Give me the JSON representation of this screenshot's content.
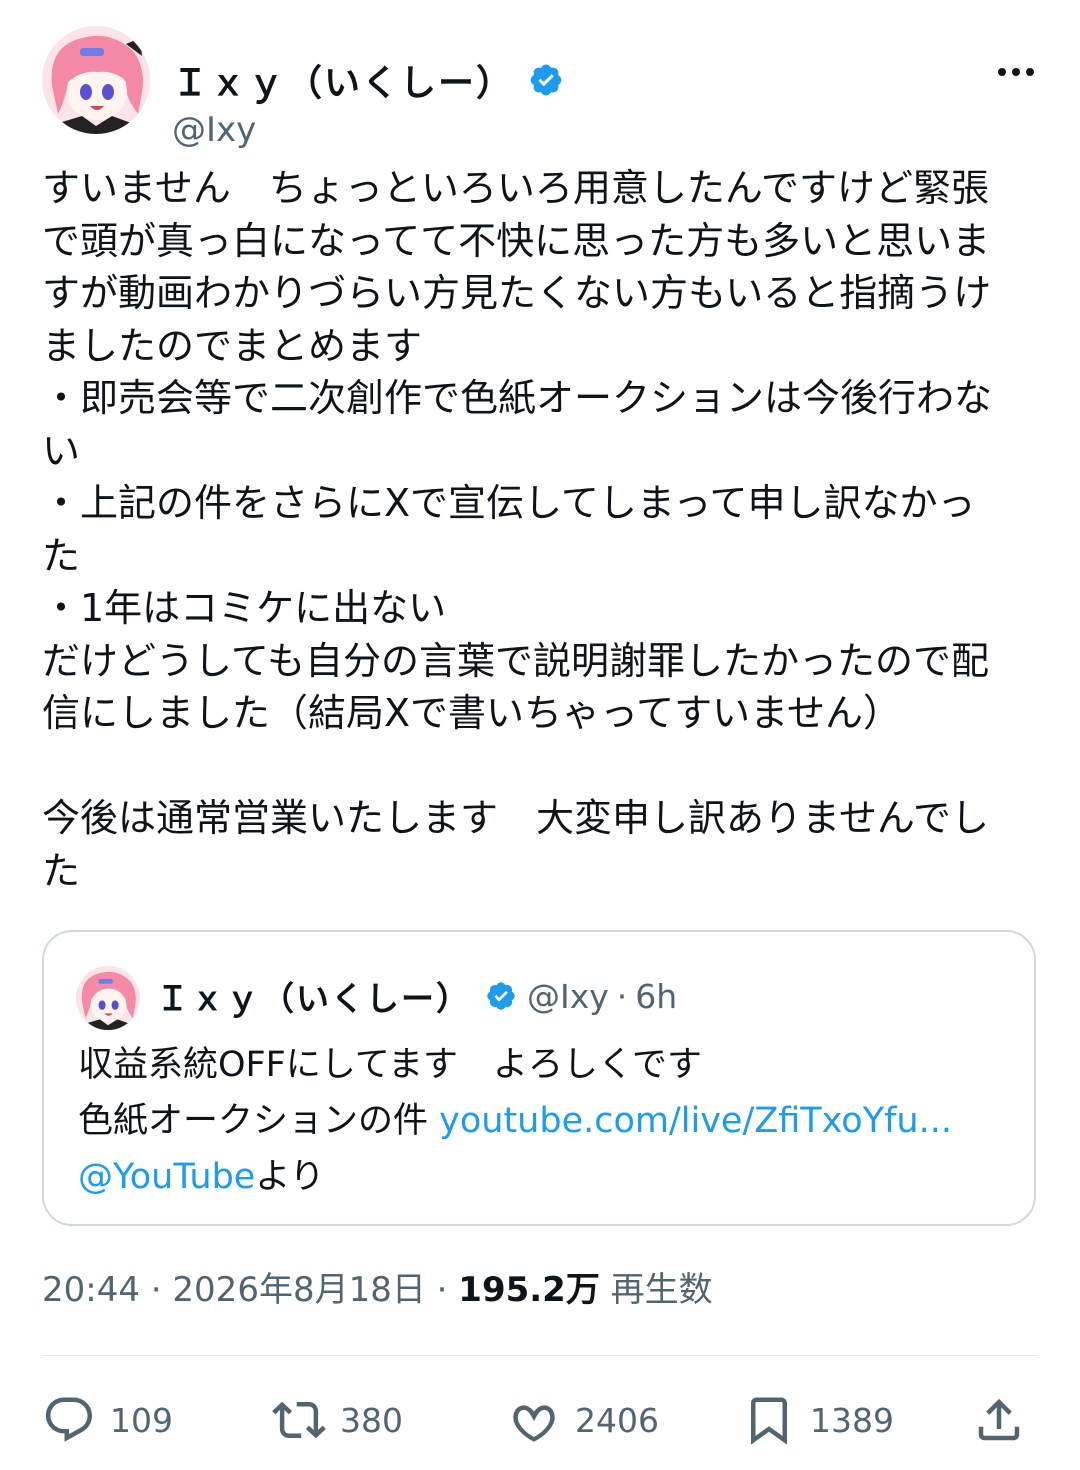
{
  "author": {
    "display_name": "Ｉｘｙ（いくしー）",
    "handle": "@Ixy",
    "verified": true
  },
  "post": {
    "text": "すいません　ちょっといろいろ用意したんですけど緊張\nで頭が真っ白になってて不快に思った方も多いと思いま\nすが動画わかりづらい方見たくない方もいると指摘うけ\nましたのでまとめます\n・即売会等で二次創作で色紙オークションは今後行わな\nい\n・上記の件をさらにXで宣伝してしまって申し訳なかっ\nた\n・1年はコミケに出ない\nだけどうしても自分の言葉で説明謝罪したかったので配\n信にしました（結局Xで書いちゃってすいません）\n\n今後は通常営業いたします　大変申し訳ありませんでし\nた",
    "time": "20:44",
    "date": "2026年8月18日",
    "views_value": "195.2万",
    "views_label": "再生数"
  },
  "quoted": {
    "display_name": "Ｉｘｙ（いくしー）",
    "handle": "@Ixy",
    "separator": "·",
    "age": "6h",
    "line1": "収益系統OFFにしてます　よろしくです",
    "line2_prefix": "色紙オークションの件 ",
    "line2_link": "youtube.com/live/ZfiTxoYfu...",
    "line3_mention": "@YouTube",
    "line3_suffix": "より"
  },
  "actions": {
    "replies": "109",
    "reposts": "380",
    "likes": "2406",
    "bookmarks": "1389"
  },
  "colors": {
    "accent": "#1d9bf0",
    "secondary_text": "#536471",
    "border": "#cfd9de"
  },
  "icons": [
    "verified-badge-icon",
    "more-icon",
    "reply-icon",
    "repost-icon",
    "like-icon",
    "bookmark-icon",
    "share-icon"
  ]
}
